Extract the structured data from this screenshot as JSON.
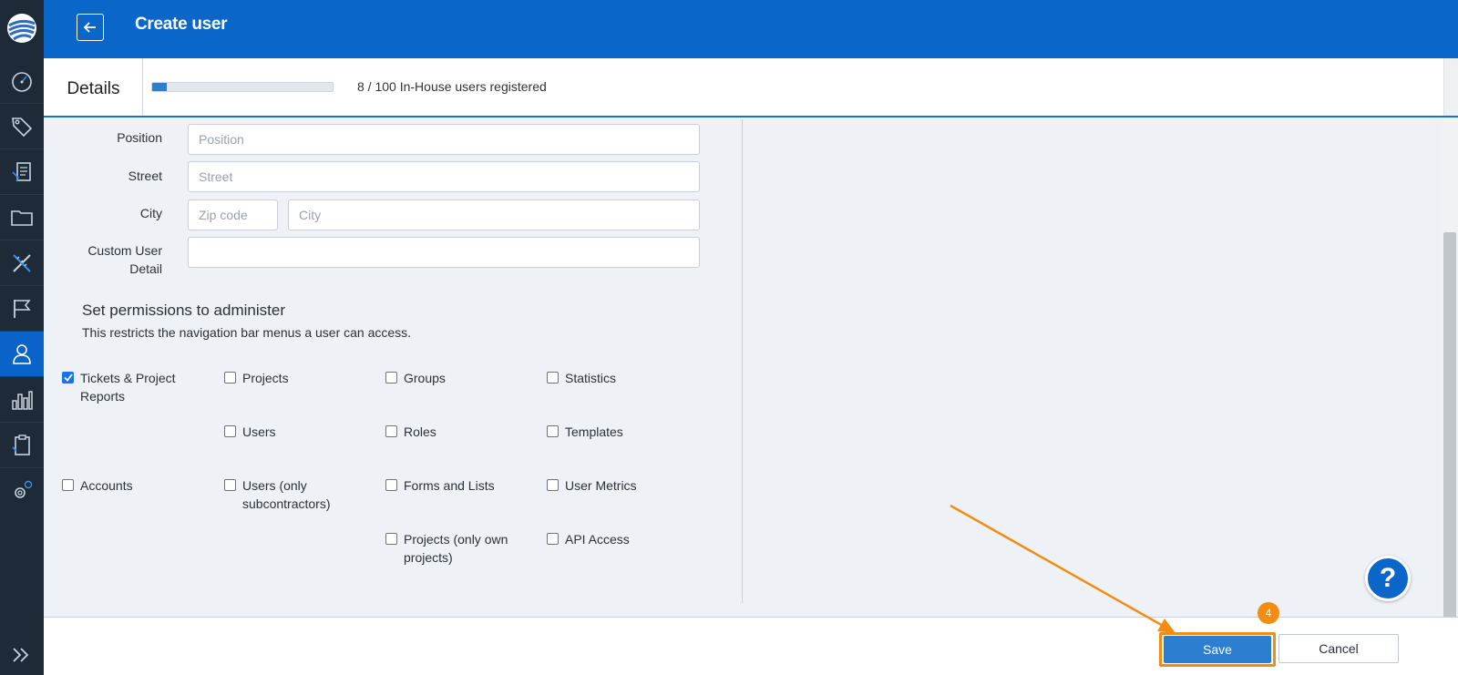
{
  "header": {
    "title": "Create user"
  },
  "details": {
    "label": "Details",
    "progress_fraction": 0.08,
    "progress_text": "8 / 100 In-House users registered"
  },
  "form": {
    "position": {
      "label": "Position",
      "placeholder": "Position",
      "value": ""
    },
    "street": {
      "label": "Street",
      "placeholder": "Street",
      "value": ""
    },
    "city": {
      "label": "City",
      "zip_placeholder": "Zip code",
      "city_placeholder": "City"
    },
    "custom_detail": {
      "label_line1": "Custom User",
      "label_line2": "Detail",
      "value": ""
    }
  },
  "permissions": {
    "title": "Set permissions to administer",
    "subtitle": "This restricts the navigation bar menus a user can access.",
    "items": [
      {
        "label_line1": "Tickets & Project",
        "label_line2": "Reports",
        "checked": true
      },
      {
        "label_line1": "Projects",
        "label_line2": "",
        "checked": false
      },
      {
        "label_line1": "Groups",
        "label_line2": "",
        "checked": false
      },
      {
        "label_line1": "Statistics",
        "label_line2": "",
        "checked": false
      },
      {
        "label_line1": "Users",
        "label_line2": "",
        "checked": false
      },
      {
        "label_line1": "Roles",
        "label_line2": "",
        "checked": false
      },
      {
        "label_line1": "Templates",
        "label_line2": "",
        "checked": false
      },
      {
        "label_line1": "Accounts",
        "label_line2": "",
        "checked": false
      },
      {
        "label_line1": "Users (only",
        "label_line2": "subcontractors)",
        "checked": false
      },
      {
        "label_line1": "Forms and Lists",
        "label_line2": "",
        "checked": false
      },
      {
        "label_line1": "User Metrics",
        "label_line2": "",
        "checked": false
      },
      {
        "label_line1": "Projects (only own",
        "label_line2": "projects)",
        "checked": false
      },
      {
        "label_line1": "API Access",
        "label_line2": "",
        "checked": false
      }
    ]
  },
  "footer": {
    "save_label": "Save",
    "cancel_label": "Cancel",
    "step_badge": "4"
  },
  "help": {
    "label": "?"
  },
  "sidebar": {
    "icons": [
      "logo-icon",
      "dashboard-icon",
      "tag-icon",
      "plans-icon",
      "folder-icon",
      "tools-icon",
      "flag-icon",
      "user-icon",
      "statistics-icon",
      "clipboard-icon",
      "settings-icon",
      "expand-icon"
    ],
    "active": "user-icon"
  },
  "colors": {
    "brand_blue": "#0a66c9",
    "sidebar_bg": "#1f2a38",
    "highlight_orange": "#f28c13"
  }
}
